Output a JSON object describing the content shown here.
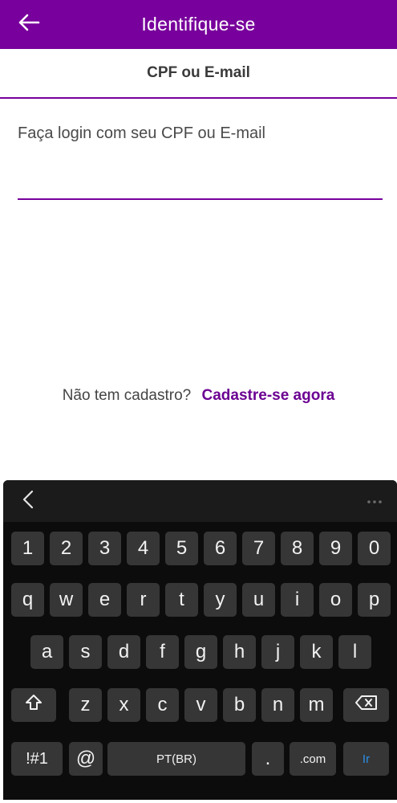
{
  "header": {
    "title": "Identifique-se",
    "back_icon": "arrow-left-icon"
  },
  "tab": {
    "label": "CPF ou E-mail"
  },
  "login": {
    "label": "Faça login com seu CPF ou E-mail",
    "value": "",
    "placeholder": ""
  },
  "signup": {
    "question": "Não tem cadastro?",
    "link": "Cadastre-se agora"
  },
  "colors": {
    "brand": "#78009c",
    "link": "#6b0092",
    "keyboard_bg": "#0c0c0c",
    "key_bg": "#363636",
    "go_key": "#2b8fe8"
  },
  "keyboard": {
    "row1": [
      "1",
      "2",
      "3",
      "4",
      "5",
      "6",
      "7",
      "8",
      "9",
      "0"
    ],
    "row2": [
      "q",
      "w",
      "e",
      "r",
      "t",
      "y",
      "u",
      "i",
      "o",
      "p"
    ],
    "row3": [
      "a",
      "s",
      "d",
      "f",
      "g",
      "h",
      "j",
      "k",
      "l"
    ],
    "row4": [
      "z",
      "x",
      "c",
      "v",
      "b",
      "n",
      "m"
    ],
    "symbols": "!#1",
    "at": "@",
    "space": "PT(BR)",
    "period": ".",
    "dotcom": ".com",
    "go": "Ir"
  }
}
